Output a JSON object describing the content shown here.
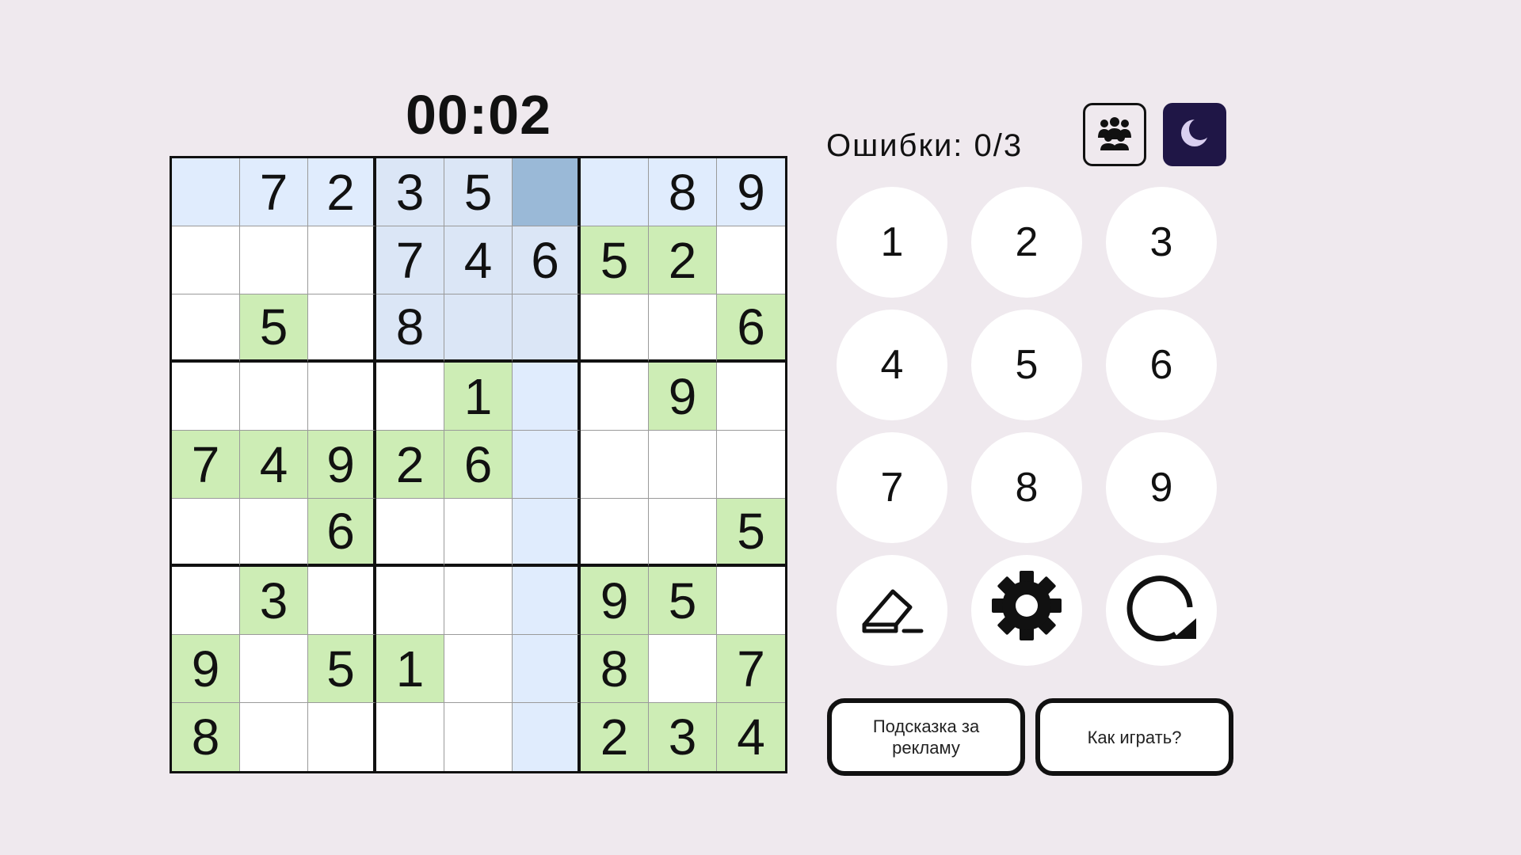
{
  "timer": "00:02",
  "errors_label": "Ошибки: 0/3",
  "grid": [
    [
      "",
      "7",
      "2",
      "3",
      "5",
      "",
      "",
      "8",
      "9"
    ],
    [
      "",
      "",
      "",
      "7",
      "4",
      "6",
      "5",
      "2",
      ""
    ],
    [
      "",
      "5",
      "",
      "8",
      "",
      "",
      "",
      "",
      "6"
    ],
    [
      "",
      "",
      "",
      "",
      "1",
      "",
      "",
      "9",
      ""
    ],
    [
      "7",
      "4",
      "9",
      "2",
      "6",
      "",
      "",
      "",
      ""
    ],
    [
      "",
      "",
      "6",
      "",
      "",
      "",
      "",
      "",
      "5"
    ],
    [
      "",
      "3",
      "",
      "",
      "",
      "",
      "9",
      "5",
      ""
    ],
    [
      "9",
      "",
      "5",
      "1",
      "",
      "",
      "8",
      "",
      "7"
    ],
    [
      "8",
      "",
      "",
      "",
      "",
      "",
      "2",
      "3",
      "4"
    ]
  ],
  "selected": [
    0,
    5
  ],
  "given_cells": [
    [
      1,
      6
    ],
    [
      1,
      7
    ],
    [
      2,
      1
    ],
    [
      2,
      8
    ],
    [
      3,
      4
    ],
    [
      3,
      7
    ],
    [
      4,
      0
    ],
    [
      4,
      1
    ],
    [
      4,
      2
    ],
    [
      4,
      3
    ],
    [
      4,
      4
    ],
    [
      5,
      2
    ],
    [
      5,
      8
    ],
    [
      6,
      1
    ],
    [
      6,
      6
    ],
    [
      6,
      7
    ],
    [
      7,
      0
    ],
    [
      7,
      2
    ],
    [
      7,
      3
    ],
    [
      7,
      6
    ],
    [
      7,
      8
    ],
    [
      8,
      0
    ],
    [
      8,
      6
    ],
    [
      8,
      7
    ],
    [
      8,
      8
    ]
  ],
  "numpad": [
    "1",
    "2",
    "3",
    "4",
    "5",
    "6",
    "7",
    "8",
    "9"
  ],
  "tools": [
    {
      "name": "eraser-icon"
    },
    {
      "name": "gear-icon"
    },
    {
      "name": "restart-icon"
    }
  ],
  "buttons": {
    "hint": "Подсказка за рекламу",
    "how_to_play": "Как играть?"
  },
  "icons": {
    "players": "players-icon",
    "theme": "moon-icon"
  },
  "colors": {
    "background": "#efe9ee",
    "highlight": "#e0ecfd",
    "box_highlight": "#dbe6f6",
    "given": "#cdedb5",
    "selected": "#9ab9d7",
    "theme_button": "#1f1646"
  }
}
